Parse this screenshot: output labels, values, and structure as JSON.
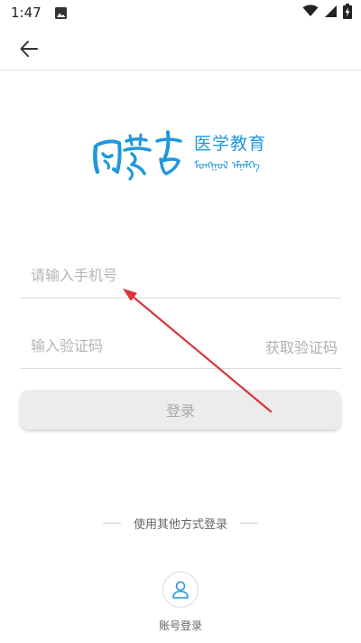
{
  "status_bar": {
    "time": "1:47",
    "left_icons": [
      "image-icon"
    ],
    "right_icons": [
      "wifi-icon",
      "signal-icon",
      "battery-charging-icon"
    ]
  },
  "top_bar": {
    "back_icon": "arrow-left-icon"
  },
  "logo": {
    "chinese_text": "医学教育",
    "mongolian_text": "ᠮᠣᠩᠭᠣᠯ ᠡᠮᠨᠡᠯᠭᠡ",
    "color": "#1f98dc"
  },
  "login_form": {
    "phone_placeholder": "请输入手机号",
    "phone_value": "",
    "code_placeholder": "输入验证码",
    "code_value": "",
    "get_code_label": "获取验证码",
    "login_label": "登录"
  },
  "other_methods": {
    "label": "使用其他方式登录",
    "account_login_icon": "user-icon",
    "account_login_label": "账号登录"
  },
  "colors": {
    "accent": "#1f98dc",
    "annotation": "#d9363a",
    "button_bg": "#ececec"
  },
  "annotation": {
    "icon": "red-arrow"
  }
}
